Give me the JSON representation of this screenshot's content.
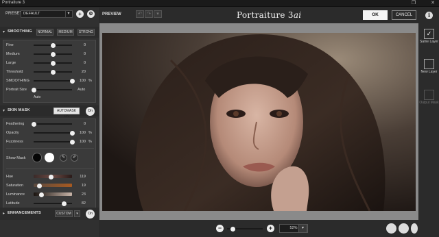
{
  "window": {
    "title": "Portraiture 3"
  },
  "preset": {
    "label": "PRESET",
    "value": "DEFAULT"
  },
  "smoothing": {
    "title": "SMOOTHING",
    "modes": [
      "NORMAL",
      "MEDIUM",
      "STRONG"
    ],
    "sliders": [
      {
        "label": "Fine",
        "value": "0",
        "unit": "",
        "level": 0.5
      },
      {
        "label": "Medium",
        "value": "0",
        "unit": "",
        "level": 0.5
      },
      {
        "label": "Large",
        "value": "0",
        "unit": "",
        "level": 0.5
      },
      {
        "label": "Threshold",
        "value": "20",
        "unit": "",
        "level": 0.5
      },
      {
        "label": "SMOOTHING",
        "value": "100",
        "unit": "%",
        "level": 1.0
      }
    ],
    "portrait_size": {
      "label": "Portrait Size",
      "value": "Auto",
      "sub": "Auto"
    }
  },
  "skin_mask": {
    "title": "SKIN MASK",
    "automask_label": "AUTOMASK ON",
    "toggle_label": "On",
    "sliders": [
      {
        "label": "Feathering",
        "value": "0",
        "unit": "",
        "level": 0.0
      },
      {
        "label": "Opacity",
        "value": "100",
        "unit": "%",
        "level": 1.0
      },
      {
        "label": "Fuzziness",
        "value": "100",
        "unit": "%",
        "level": 1.0
      }
    ],
    "show_mask_label": "Show Mask",
    "color_sliders": [
      {
        "label": "Hue",
        "value": "119",
        "level": 0.45
      },
      {
        "label": "Saturation",
        "value": "19",
        "level": 0.15
      },
      {
        "label": "Luminance",
        "value": "23",
        "level": 0.2
      },
      {
        "label": "Latitude",
        "value": "82",
        "level": 0.8
      }
    ]
  },
  "enhancements": {
    "title": "ENHANCEMENTS",
    "preset": "CUSTOM",
    "toggle_label": "On"
  },
  "toolbar": {
    "preview_label": "PREVIEW",
    "brand_main": "Portraiture 3",
    "brand_suffix": "ai",
    "ok_label": "OK",
    "cancel_label": "CANCEL"
  },
  "right_panel": {
    "same_layer": "Same Layer",
    "new_layer": "New Layer",
    "output_mask": "Output Mask"
  },
  "zoom": {
    "value": "52%"
  },
  "colors": {
    "accent": "#f5f5f5",
    "panel": "#303030",
    "bg": "#2b2b2b"
  }
}
